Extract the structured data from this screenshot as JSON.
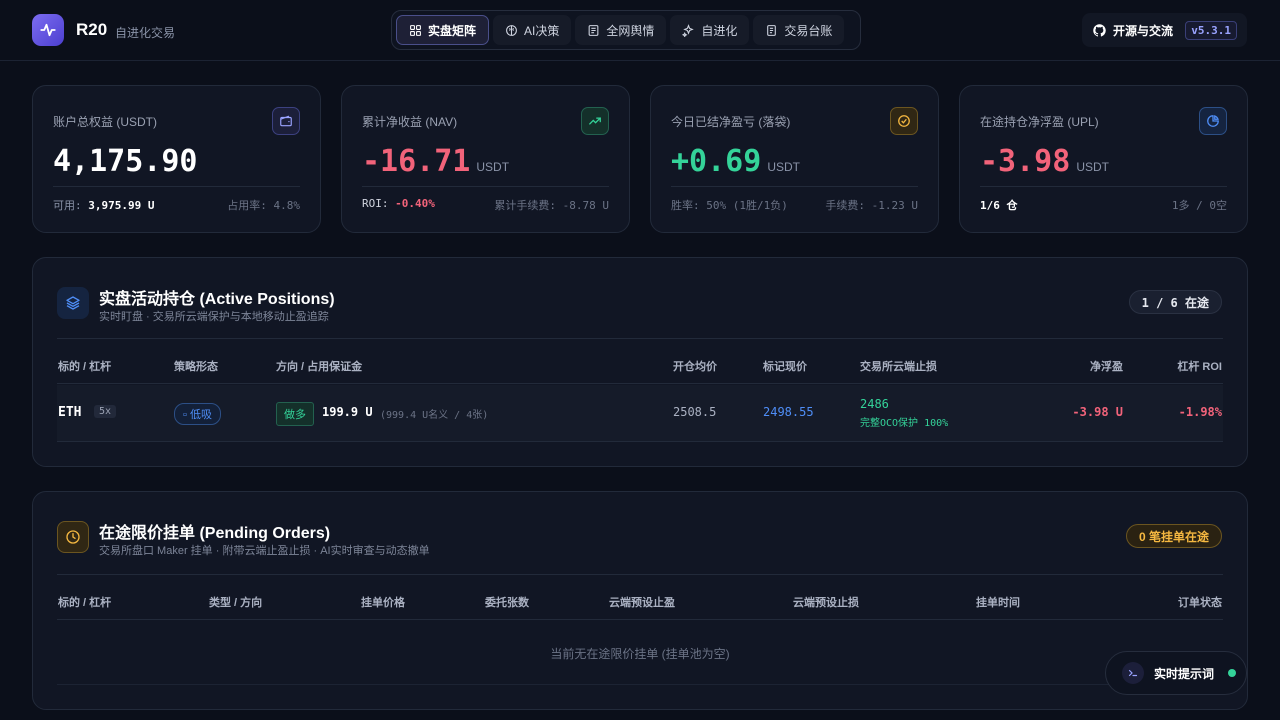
{
  "header": {
    "brand": "R20",
    "brand_sub": "自进化交易",
    "tabs": [
      {
        "label": "实盘矩阵",
        "icon": "grid-icon"
      },
      {
        "label": "AI决策",
        "icon": "brain-icon"
      },
      {
        "label": "全网舆情",
        "icon": "news-icon"
      },
      {
        "label": "自进化",
        "icon": "sparkles-icon"
      },
      {
        "label": "交易台账",
        "icon": "ledger-icon"
      }
    ],
    "github_label": "开源与交流",
    "version": "v5.3.1"
  },
  "cards": [
    {
      "label": "账户总权益 (USDT)",
      "value": "4,175.90",
      "unit": "",
      "foot_left_label": "可用: ",
      "foot_left_value": "3,975.99 U",
      "foot_right": "占用率: 4.8%",
      "color": "#ffffff"
    },
    {
      "label": "累计净收益 (NAV)",
      "value": "-16.71",
      "unit": "USDT",
      "foot_left_label": "ROI: ",
      "foot_left_value": "-0.40%",
      "foot_right": "累计手续费: -8.78 U",
      "color": "#f2637a"
    },
    {
      "label": "今日已结净盈亏 (落袋)",
      "value": "+0.69",
      "unit": "USDT",
      "foot_left_label": "胜率: 50% (1胜/1负)",
      "foot_left_value": "",
      "foot_right": "手续费: -1.23 U",
      "color": "#34d399"
    },
    {
      "label": "在途持仓净浮盈 (UPL)",
      "value": "-3.98",
      "unit": "USDT",
      "foot_left_label": "",
      "foot_left_value": "1/6 仓",
      "foot_right": "1多 / 0空",
      "color": "#f2637a"
    }
  ],
  "positions": {
    "title": "实盘活动持仓 (Active Positions)",
    "subtitle": "实时盯盘 · 交易所云端保护与本地移动止盈追踪",
    "badge": "1 / 6 在途",
    "columns": [
      "标的 / 杠杆",
      "策略形态",
      "方向 / 占用保证金",
      "开仓均价",
      "标记现价",
      "交易所云端止损",
      "净浮盈",
      "杠杆 ROI"
    ],
    "rows": [
      {
        "symbol": "ETH",
        "leverage": "5x",
        "strategy": "低吸",
        "side": "做多",
        "margin": "199.9 U",
        "notional": "(999.4 U名义 / 4张)",
        "entry": "2508.5",
        "mark": "2498.55",
        "sl": "2486",
        "sl_note": "完整OCO保护 100%",
        "pnl": "-3.98 U",
        "roi": "-1.98%"
      }
    ]
  },
  "orders": {
    "title": "在途限价挂单 (Pending Orders)",
    "subtitle": "交易所盘口 Maker 挂单 · 附带云端止盈止损 · AI实时审查与动态撤单",
    "badge": "0 笔挂单在途",
    "columns": [
      "标的 / 杠杆",
      "类型 / 方向",
      "挂单价格",
      "委托张数",
      "云端预设止盈",
      "云端预设止损",
      "挂单时间",
      "订单状态"
    ],
    "empty": "当前无在途限价挂单 (挂单池为空)"
  },
  "prompt_button": "实时提示词",
  "colors": {
    "accent": "#6d5ee8",
    "up": "#34d399",
    "down": "#f2637a",
    "blue": "#4f8ef7",
    "gold": "#f5b841"
  }
}
